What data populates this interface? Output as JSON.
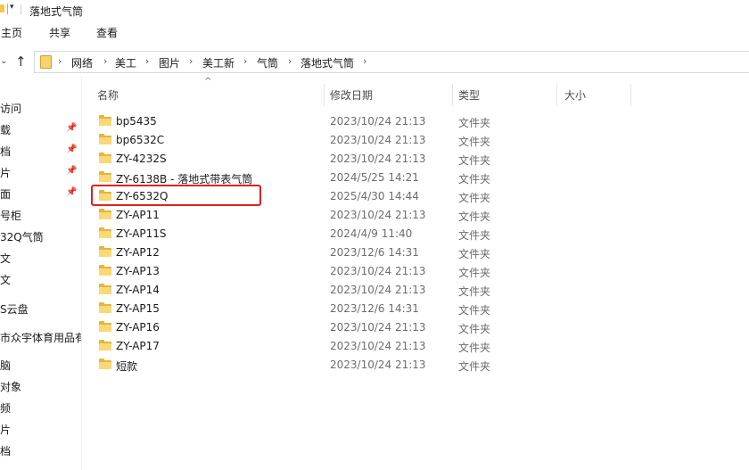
{
  "window": {
    "title": "落地式气筒"
  },
  "ribbon": {
    "tabs": [
      "主页",
      "共享",
      "查看"
    ]
  },
  "address": {
    "crumbs": [
      "网络",
      "美工",
      "图片",
      "美工新",
      "气筒",
      "落地式气筒"
    ]
  },
  "sidebar": {
    "items": [
      {
        "label": "访问",
        "pinned": false
      },
      {
        "label": "载",
        "pinned": true
      },
      {
        "label": "档",
        "pinned": true
      },
      {
        "label": "片",
        "pinned": true
      },
      {
        "label": "面",
        "pinned": true
      },
      {
        "label": "号柜",
        "pinned": false
      },
      {
        "label": "32Q气筒",
        "pinned": false
      },
      {
        "label": "文",
        "pinned": false
      },
      {
        "label": "文",
        "pinned": false
      },
      {
        "label": "S云盘",
        "pinned": false
      },
      {
        "label": "市众宇体育用品有",
        "pinned": false
      },
      {
        "label": "脑",
        "pinned": false
      },
      {
        "label": "对象",
        "pinned": false
      },
      {
        "label": "频",
        "pinned": false
      },
      {
        "label": "片",
        "pinned": false
      },
      {
        "label": "档",
        "pinned": false
      },
      {
        "label": "",
        "pinned": false
      }
    ]
  },
  "columns": {
    "name": "名称",
    "modified": "修改日期",
    "type": "类型",
    "size": "大小"
  },
  "files": [
    {
      "name": "bp5435",
      "modified": "2023/10/24 21:13",
      "type": "文件夹"
    },
    {
      "name": "bp6532C",
      "modified": "2023/10/24 21:13",
      "type": "文件夹"
    },
    {
      "name": "ZY-4232S",
      "modified": "2023/10/24 21:13",
      "type": "文件夹"
    },
    {
      "name": "ZY-6138B - 落地式带表气筒",
      "modified": "2024/5/25 14:21",
      "type": "文件夹"
    },
    {
      "name": "ZY-6532Q",
      "modified": "2025/4/30 14:44",
      "type": "文件夹"
    },
    {
      "name": "ZY-AP11",
      "modified": "2023/10/24 21:13",
      "type": "文件夹"
    },
    {
      "name": "ZY-AP11S",
      "modified": "2024/4/9 11:40",
      "type": "文件夹"
    },
    {
      "name": "ZY-AP12",
      "modified": "2023/12/6 14:31",
      "type": "文件夹"
    },
    {
      "name": "ZY-AP13",
      "modified": "2023/10/24 21:13",
      "type": "文件夹"
    },
    {
      "name": "ZY-AP14",
      "modified": "2023/10/24 21:13",
      "type": "文件夹"
    },
    {
      "name": "ZY-AP15",
      "modified": "2023/12/6 14:31",
      "type": "文件夹"
    },
    {
      "name": "ZY-AP16",
      "modified": "2023/10/24 21:13",
      "type": "文件夹"
    },
    {
      "name": "ZY-AP17",
      "modified": "2023/10/24 21:13",
      "type": "文件夹"
    },
    {
      "name": "短款",
      "modified": "2023/10/24 21:13",
      "type": "文件夹"
    }
  ],
  "highlight": {
    "color": "#e02020"
  }
}
